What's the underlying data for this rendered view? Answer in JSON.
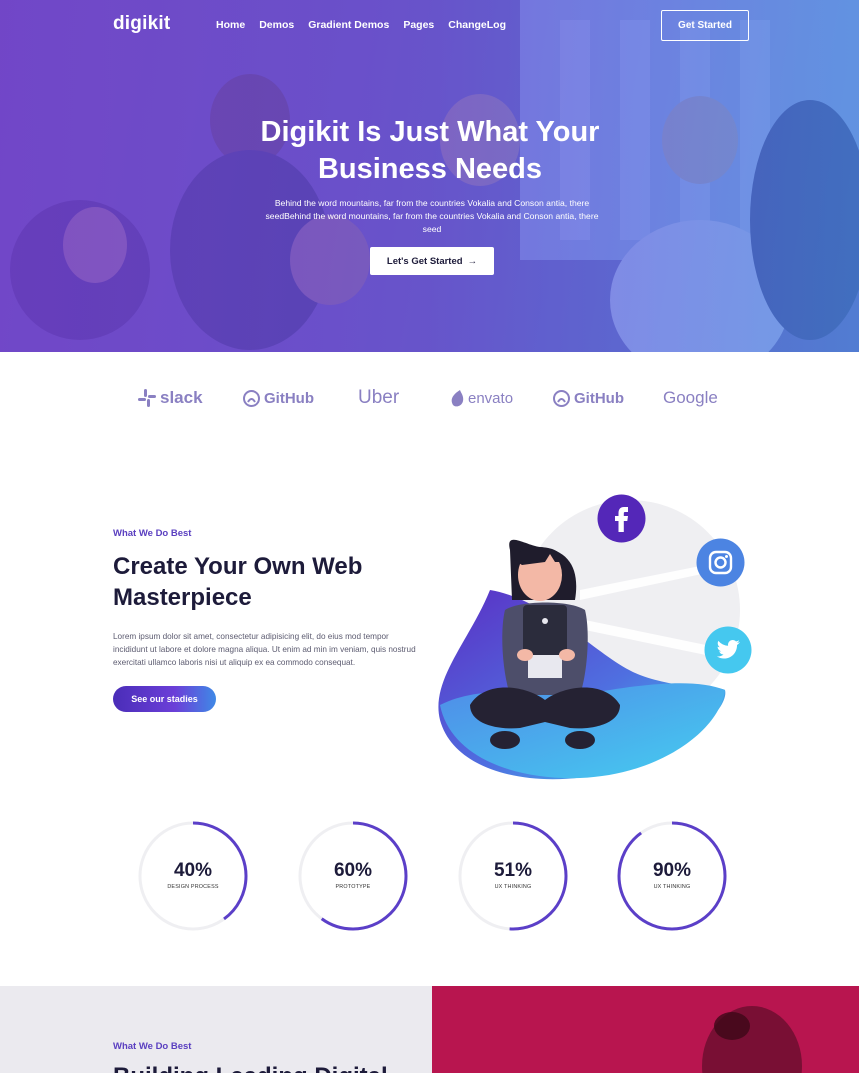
{
  "nav": {
    "logo": "digikit",
    "links": [
      "Home",
      "Demos",
      "Gradient Demos",
      "Pages",
      "ChangeLog"
    ],
    "cta": "Get Started"
  },
  "hero": {
    "title_line1": "Digikit Is Just What Your",
    "title_line2": "Business Needs",
    "subtitle": "Behind the word mountains, far from the countries Vokalia and Conson antia, there seedBehind the word mountains, far from the countries Vokalia and Conson antia, there seed",
    "button": "Let's Get Started",
    "button_arrow": "→"
  },
  "brands": [
    "slack",
    "GitHub",
    "Uber",
    "envato",
    "GitHub",
    "Google"
  ],
  "what_we_do": {
    "eyebrow": "What We Do Best",
    "title_line1": "Create Your Own Web",
    "title_line2": "Masterpiece",
    "body": "Lorem ipsum dolor sit amet, consectetur adipisicing elit, do eius mod tempor incididunt ut labore et dolore magna aliqua. Ut enim ad min im veniam, quis nostrud exercitati ullamco laboris nisi ut aliquip ex ea commodo consequat.",
    "button": "See our stadies"
  },
  "social_icons": [
    "facebook-icon",
    "instagram-icon",
    "twitter-icon"
  ],
  "stats": [
    {
      "value": "40%",
      "label": "DESIGN PROCESS",
      "progress": 0.4
    },
    {
      "value": "60%",
      "label": "PROTOTYPE",
      "progress": 0.6
    },
    {
      "value": "51%",
      "label": "UX THINKING",
      "progress": 0.51
    },
    {
      "value": "90%",
      "label": "UX THINKING",
      "progress": 0.9
    }
  ],
  "bottom": {
    "eyebrow": "What We Do Best",
    "title": "Building Leading Digital"
  },
  "colors": {
    "accent": "#5a3fc0",
    "ring": "#5b3fc8",
    "ring_track": "#efeff2",
    "bottom_right": "#b8154f"
  }
}
